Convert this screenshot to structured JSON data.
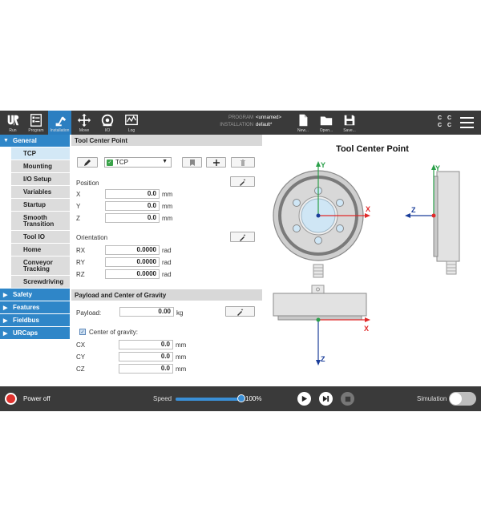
{
  "toolbar": {
    "run": "Run",
    "program": "Program",
    "installation": "Installation",
    "move": "Move",
    "io": "I/O",
    "log": "Log",
    "program_key": "PROGRAM",
    "program_value": "<unnamed>",
    "installation_key": "INSTALLATION",
    "installation_value": "default*",
    "new": "New...",
    "open": "Open...",
    "save": "Save...",
    "cc": [
      "C",
      "C",
      "C",
      "C"
    ]
  },
  "nav": {
    "general": "General",
    "items": [
      "TCP",
      "Mounting",
      "I/O Setup",
      "Variables",
      "Startup",
      "Smooth Transition",
      "Tool IO",
      "Home",
      "Conveyor Tracking",
      "Screwdriving"
    ],
    "safety": "Safety",
    "features": "Features",
    "fieldbus": "Fieldbus",
    "urcaps": "URCaps"
  },
  "tcp": {
    "header": "Tool Center Point",
    "selected": "TCP",
    "position_label": "Position",
    "orientation_label": "Orientation",
    "x_label": "X",
    "x_value": "0.0",
    "x_unit": "mm",
    "y_label": "Y",
    "y_value": "0.0",
    "y_unit": "mm",
    "z_label": "Z",
    "z_value": "0.0",
    "z_unit": "mm",
    "rx_label": "RX",
    "rx_value": "0.0000",
    "rx_unit": "rad",
    "ry_label": "RY",
    "ry_value": "0.0000",
    "ry_unit": "rad",
    "rz_label": "RZ",
    "rz_value": "0.0000",
    "rz_unit": "rad"
  },
  "payload": {
    "header": "Payload and Center of Gravity",
    "payload_label": "Payload:",
    "payload_value": "0.00",
    "payload_unit": "kg",
    "cog_label": "Center of gravity:",
    "cx_label": "CX",
    "cx_value": "0.0",
    "cx_unit": "mm",
    "cy_label": "CY",
    "cy_value": "0.0",
    "cy_unit": "mm",
    "cz_label": "CZ",
    "cz_value": "0.0",
    "cz_unit": "mm"
  },
  "diagram": {
    "title": "Tool Center Point",
    "axis_x": "X",
    "axis_y": "Y",
    "axis_z": "Z",
    "x_color": "#e02a2a",
    "y_color": "#2aa04a",
    "z_color": "#1a3d9a"
  },
  "footer": {
    "power": "Power off",
    "speed_label": "Speed",
    "speed_value": "100%",
    "speed_fraction": 1.0,
    "simulation_label": "Simulation"
  }
}
